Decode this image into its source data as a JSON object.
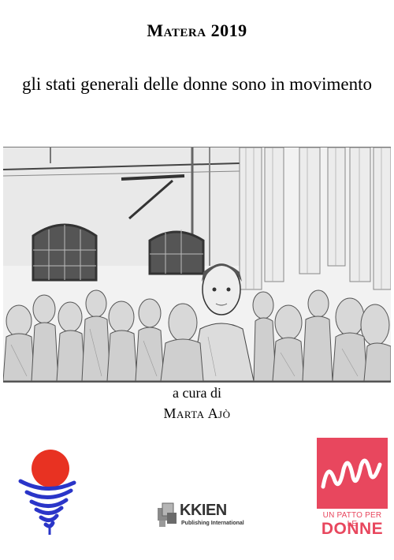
{
  "cover": {
    "title": "Matera 2019",
    "subtitle": "gli stati generali delle donne sono in movimento",
    "editor_label": "a cura di",
    "editor_name": "Marta Ajò"
  },
  "logos": {
    "center": {
      "brand": "KKIEN",
      "tagline": "Publishing International"
    },
    "right": {
      "line1": "UN PATTO PER LE",
      "line2": "DONNE",
      "color": "#e8475e"
    },
    "left": {
      "sun_color": "#e83222",
      "spiral_color": "#2a35c8"
    }
  },
  "icons": [
    "sun-spiral-logo",
    "kkien-logo",
    "patto-donne-logo"
  ]
}
